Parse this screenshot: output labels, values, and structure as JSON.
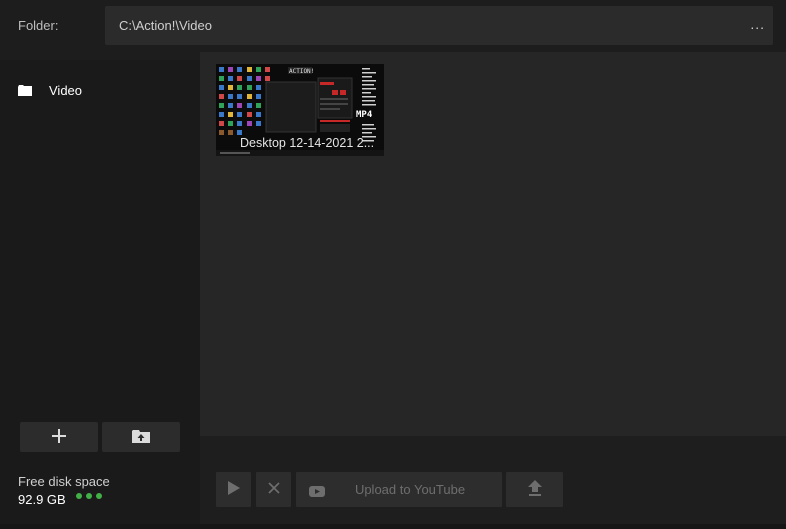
{
  "header": {
    "folder_label": "Folder:",
    "folder_path": "C:\\Action!\\Video",
    "browse_label": "..."
  },
  "sidebar": {
    "items": [
      {
        "label": "Video",
        "icon": "folder-icon"
      }
    ],
    "add_button_icon": "plus-icon",
    "open_folder_button_icon": "folder-open-icon",
    "disk": {
      "label": "Free disk space",
      "value": "92.9 GB",
      "indicator_color": "#43b047"
    }
  },
  "content": {
    "files": [
      {
        "caption": "Desktop 12-14-2021 2...",
        "badge": "MP4"
      }
    ]
  },
  "bottom": {
    "play_icon": "play-icon",
    "delete_icon": "close-icon",
    "upload_youtube_label": "Upload to YouTube",
    "upload_icon": "upload-icon"
  },
  "colors": {
    "background": "#1d1d1d",
    "panel": "#262626",
    "accent_red": "#c62828"
  }
}
